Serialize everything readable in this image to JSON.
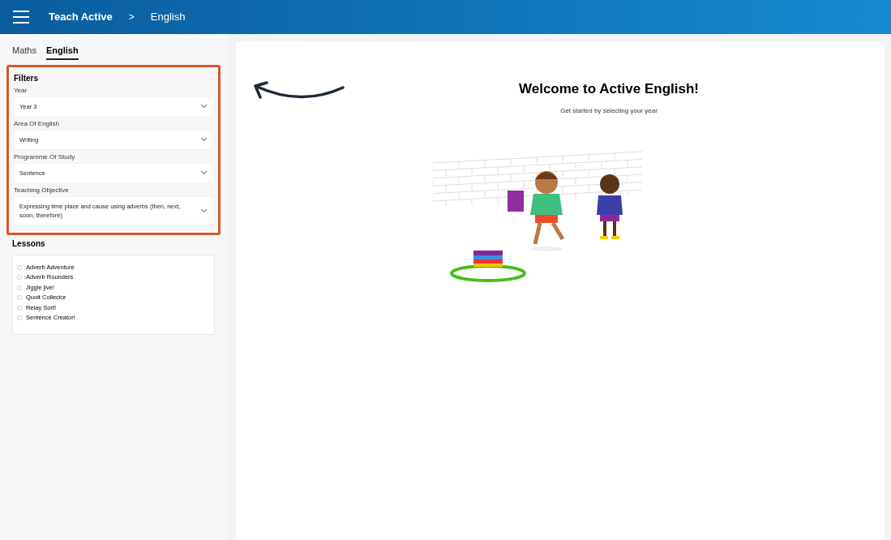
{
  "header": {
    "app_title": "Teach Active",
    "separator": ">",
    "section": "English"
  },
  "subject_tabs": [
    {
      "label": "Maths",
      "selected": false
    },
    {
      "label": "English",
      "selected": true
    }
  ],
  "filters": {
    "title": "Filters",
    "highlighted": true,
    "fields": [
      {
        "label": "Year",
        "value": "Year 3"
      },
      {
        "label": "Area Of English",
        "value": "Writing"
      },
      {
        "label": "Programme Of Study",
        "value": "Sentence"
      },
      {
        "label": "Teaching Objective",
        "value": "Expressing time place and cause using adverbs (then, next, soon, therefore)"
      }
    ]
  },
  "lessons": {
    "title": "Lessons",
    "items": [
      {
        "label": "Adverb Adventure",
        "selected": false
      },
      {
        "label": "Adverb Rounders",
        "selected": false
      },
      {
        "label": "Jiggle jive!",
        "selected": false
      },
      {
        "label": "Quoit Collector",
        "selected": false
      },
      {
        "label": "Relay Sort!",
        "selected": false
      },
      {
        "label": "Sentence Creator!",
        "selected": false
      }
    ]
  },
  "welcome": {
    "title": "Welcome to Active English!",
    "subtitle": "Get started by selecting your year"
  }
}
